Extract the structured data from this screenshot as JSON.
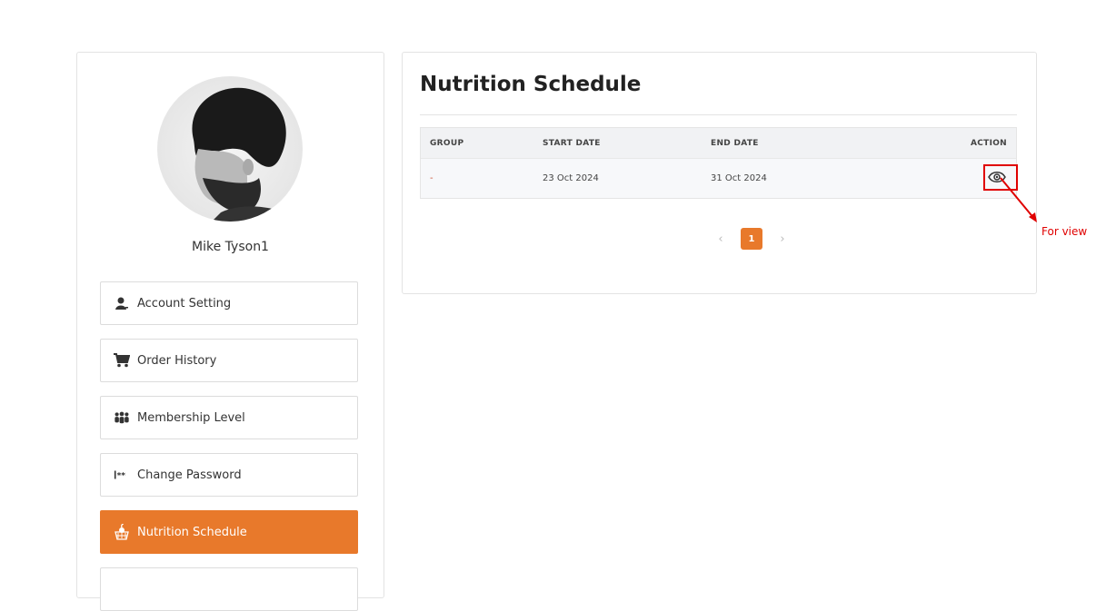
{
  "user": {
    "name": "Mike Tyson1"
  },
  "menu": {
    "items": [
      {
        "label": "Account Setting",
        "icon": "user-icon"
      },
      {
        "label": "Order History",
        "icon": "cart-icon"
      },
      {
        "label": "Membership Level",
        "icon": "group-icon"
      },
      {
        "label": "Change Password",
        "icon": "password-icon"
      },
      {
        "label": "Nutrition Schedule",
        "icon": "apple-basket-icon",
        "active": true
      }
    ]
  },
  "main": {
    "title": "Nutrition Schedule",
    "table": {
      "headers": [
        "GROUP",
        "START DATE",
        "END DATE",
        "ACTION"
      ],
      "rows": [
        {
          "group": "-",
          "start_date": "23 Oct 2024",
          "end_date": "31 Oct 2024",
          "action_icon": "eye-icon"
        }
      ]
    },
    "pagination": {
      "prev": "‹",
      "current": "1",
      "next": "›"
    }
  },
  "annotation": {
    "text": "For view",
    "color": "#e00000"
  },
  "colors": {
    "accent": "#e8792b"
  }
}
